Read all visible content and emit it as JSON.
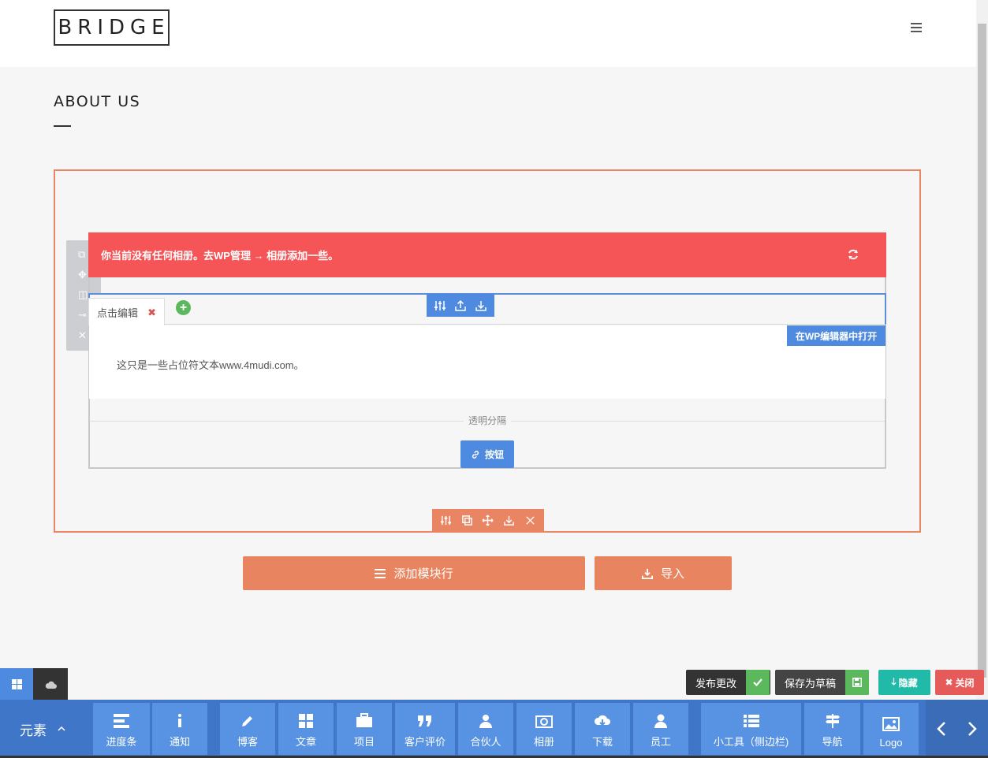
{
  "header": {
    "logo_text": "BRIDGE"
  },
  "page": {
    "title": "ABOUT US"
  },
  "alert": {
    "message": "你当前没有任何相册。去WP管理 → 相册添加一些。"
  },
  "tab": {
    "label": "点击编辑",
    "close": "✖",
    "add": "+"
  },
  "content": {
    "text": "这只是一些占位符文本www.4mudi.com。",
    "open_wp_editor": "在WP编辑器中打开"
  },
  "separator": {
    "label": "透明分隔"
  },
  "button_element": {
    "label": "按钮"
  },
  "actions": {
    "add_row": "添加模块行",
    "import": "导入",
    "publish": "发布更改",
    "save_draft": "保存为草稿",
    "hide": "隐藏",
    "close": "关闭"
  },
  "bottom_bar": {
    "elements_label": "元素",
    "items": [
      "进度条",
      "通知",
      "博客",
      "文章",
      "项目",
      "客户评价",
      "合伙人",
      "相册",
      "下载",
      "员工",
      "小工具（侧边栏)",
      "导航",
      "Logo"
    ]
  },
  "colors": {
    "accent_orange": "#ea8563",
    "accent_blue": "#4d8ae0",
    "alert_red": "#f65558",
    "bar_blue": "#3f76c8"
  }
}
